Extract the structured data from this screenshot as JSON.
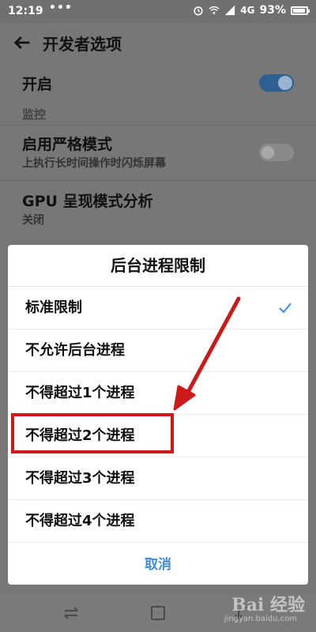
{
  "status_bar": {
    "time": "12:19",
    "dots": "•••",
    "network": "4G",
    "battery": "93%",
    "battery_level": 0.93,
    "icons": [
      "alarm-icon",
      "wifi-icon",
      "signal-icon",
      "battery-icon"
    ]
  },
  "settings": {
    "title": "开发者选项",
    "enable_label": "开启",
    "enable_on": true,
    "section_monitor": "监控",
    "strict_mode": {
      "title": "启用严格模式",
      "sub": "上执行长时间操作时闪烁屏幕",
      "on": false
    },
    "gpu": {
      "title": "GPU 呈现模式分析",
      "sub": "关闭"
    }
  },
  "dialog": {
    "title": "后台进程限制",
    "options": [
      {
        "label": "标准限制",
        "selected": true
      },
      {
        "label": "不允许后台进程",
        "selected": false
      },
      {
        "label": "不得超过1个进程",
        "selected": false
      },
      {
        "label": "不得超过2个进程",
        "selected": false
      },
      {
        "label": "不得超过3个进程",
        "selected": false
      },
      {
        "label": "不得超过4个进程",
        "selected": false
      }
    ],
    "cancel": "取消"
  },
  "annotation": {
    "color": "#cc1a1a",
    "highlighted_option": "不得超过2个进程"
  },
  "watermark": {
    "text": "Bai 经验",
    "sub": "jingyan.baidu.com"
  },
  "colors": {
    "accent": "#3c8de0",
    "toggle_on": "#2e5f93"
  }
}
